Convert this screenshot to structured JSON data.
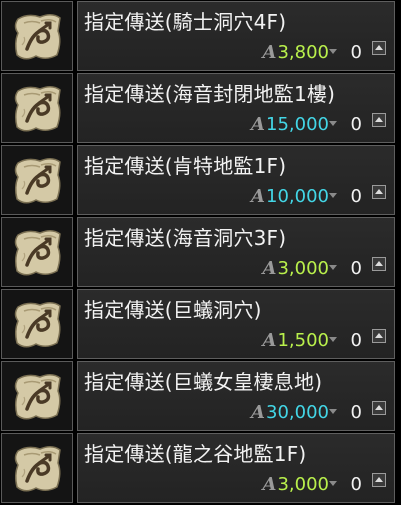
{
  "currency_symbol": "A",
  "items": [
    {
      "name": "指定傳送(騎士洞穴4F)",
      "price": "3,800",
      "price_color": "green",
      "quantity": "0"
    },
    {
      "name": "指定傳送(海音封閉地監1樓)",
      "price": "15,000",
      "price_color": "cyan",
      "quantity": "0"
    },
    {
      "name": "指定傳送(肯特地監1F)",
      "price": "10,000",
      "price_color": "cyan",
      "quantity": "0"
    },
    {
      "name": "指定傳送(海音洞穴3F)",
      "price": "3,000",
      "price_color": "green",
      "quantity": "0"
    },
    {
      "name": "指定傳送(巨蟻洞穴)",
      "price": "1,500",
      "price_color": "green",
      "quantity": "0"
    },
    {
      "name": "指定傳送(巨蟻女皇棲息地)",
      "price": "30,000",
      "price_color": "cyan",
      "quantity": "0"
    },
    {
      "name": "指定傳送(龍之谷地監1F)",
      "price": "3,000",
      "price_color": "green",
      "quantity": "0"
    }
  ],
  "colors": {
    "price_green": "#b9f04c",
    "price_cyan": "#43d6e6",
    "panel_bg": "#262626",
    "border": "#5e5e5e"
  },
  "icons": {
    "item_icon": "teleport-scroll-icon",
    "currency_icon": "adena-icon",
    "decrease": "arrow-down-icon",
    "increase": "arrow-up-icon"
  }
}
